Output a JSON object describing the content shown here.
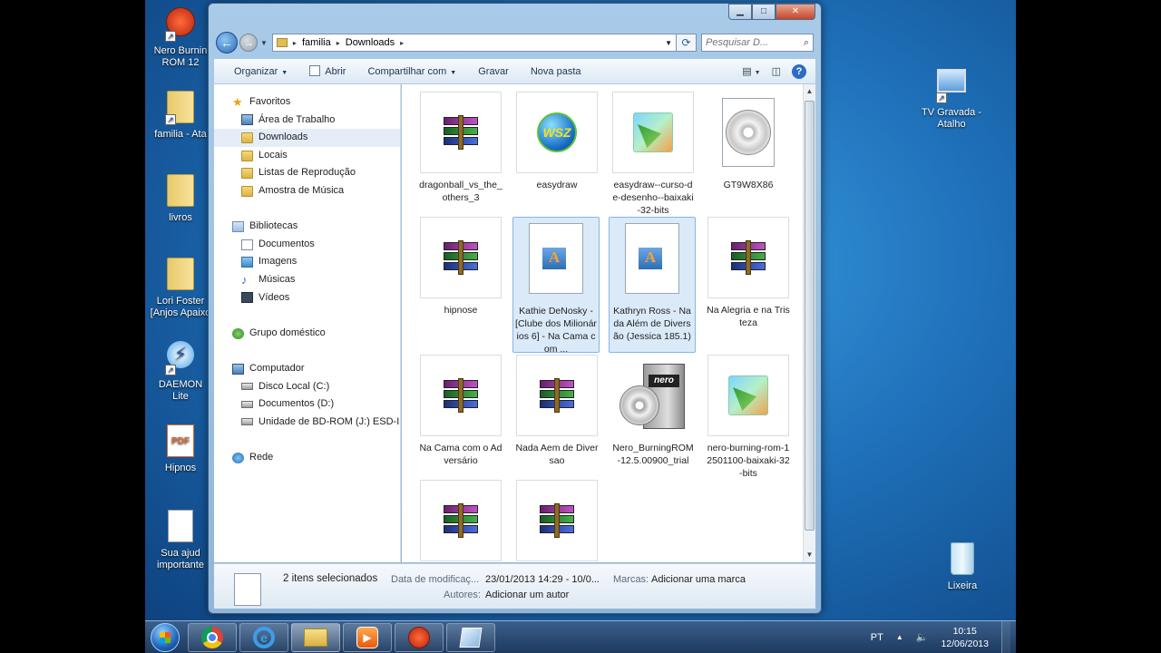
{
  "desktop": {
    "icons_left": [
      {
        "label": "Nero Burnin\nROM 12"
      },
      {
        "label": "familia - Ata"
      },
      {
        "label": "livros"
      },
      {
        "label": "Lori Foster\n[Anjos Apaixo"
      },
      {
        "label": "DAEMON\nLite"
      },
      {
        "label": "Hipnos"
      },
      {
        "label": "Sua ajud\nimportante"
      }
    ],
    "icons_right": [
      {
        "label": "TV Gravada -\nAtalho"
      },
      {
        "label": "Lixeira"
      }
    ]
  },
  "window": {
    "controls": {
      "minimize": "▁",
      "maximize": "□",
      "close": "✕"
    },
    "address": {
      "crumbs": [
        "familia",
        "Downloads"
      ]
    },
    "search": {
      "placeholder": "Pesquisar D..."
    },
    "toolbar": {
      "organize": "Organizar",
      "open": "Abrir",
      "share": "Compartilhar com",
      "burn": "Gravar",
      "new_folder": "Nova pasta"
    },
    "nav": {
      "favorites": "Favoritos",
      "fav_items": [
        "Área de Trabalho",
        "Downloads",
        "Locais",
        "Listas de Reprodução",
        "Amostra de Música"
      ],
      "libraries": "Bibliotecas",
      "lib_items": [
        "Documentos",
        "Imagens",
        "Músicas",
        "Vídeos"
      ],
      "homegroup": "Grupo doméstico",
      "computer": "Computador",
      "computer_items": [
        "Disco Local (C:)",
        "Documentos (D:)",
        "Unidade de BD-ROM (J:) ESD-ISO"
      ],
      "network": "Rede"
    },
    "files": [
      {
        "name": "dragonball_vs_the_others_3",
        "icon": "winrar-archive",
        "selected": false
      },
      {
        "name": "easydraw",
        "icon": "globe-wsz",
        "selected": false
      },
      {
        "name": "easydraw--curso-de-desenho--baixaki-32-bits",
        "icon": "setup-package",
        "selected": false
      },
      {
        "name": "GT9W8X86",
        "icon": "disc-image",
        "selected": false
      },
      {
        "name": "hipnose",
        "icon": "winrar-archive",
        "selected": false
      },
      {
        "name": "Kathie DeNosky - [Clube dos Milionários 6] - Na Cama com ...",
        "icon": "document",
        "selected": true
      },
      {
        "name": "Kathryn Ross - Nada Além de Diversão (Jessica 185.1)",
        "icon": "document",
        "selected": true
      },
      {
        "name": "Na Alegria e na Tristeza",
        "icon": "winrar-archive",
        "selected": false
      },
      {
        "name": "Na Cama com o Adversário",
        "icon": "winrar-archive",
        "selected": false
      },
      {
        "name": "Nada Aem de Diversao",
        "icon": "winrar-archive",
        "selected": false
      },
      {
        "name": "Nero_BurningROM-12.5.00900_trial",
        "icon": "nero-box",
        "selected": false
      },
      {
        "name": "nero-burning-rom-12501100-baixaki-32-bits",
        "icon": "setup-package",
        "selected": false
      },
      {
        "name": "",
        "icon": "winrar-archive",
        "selected": false
      },
      {
        "name": "",
        "icon": "winrar-archive",
        "selected": false
      }
    ],
    "details": {
      "selected_count": "2 itens selecionados",
      "modified_label": "Data de modificaç...",
      "modified_value": "23/01/2013 14:29 - 10/0...",
      "tags_label": "Marcas:",
      "tags_value": "Adicionar uma marca",
      "authors_label": "Autores:",
      "authors_value": "Adicionar um autor"
    }
  },
  "taskbar": {
    "apps": [
      "chrome-icon",
      "internet-explorer-icon",
      "explorer-folder-icon",
      "media-player-icon",
      "nero-icon",
      "explorer-window-icon"
    ],
    "language": "PT",
    "time": "10:15",
    "date": "12/06/2013"
  }
}
